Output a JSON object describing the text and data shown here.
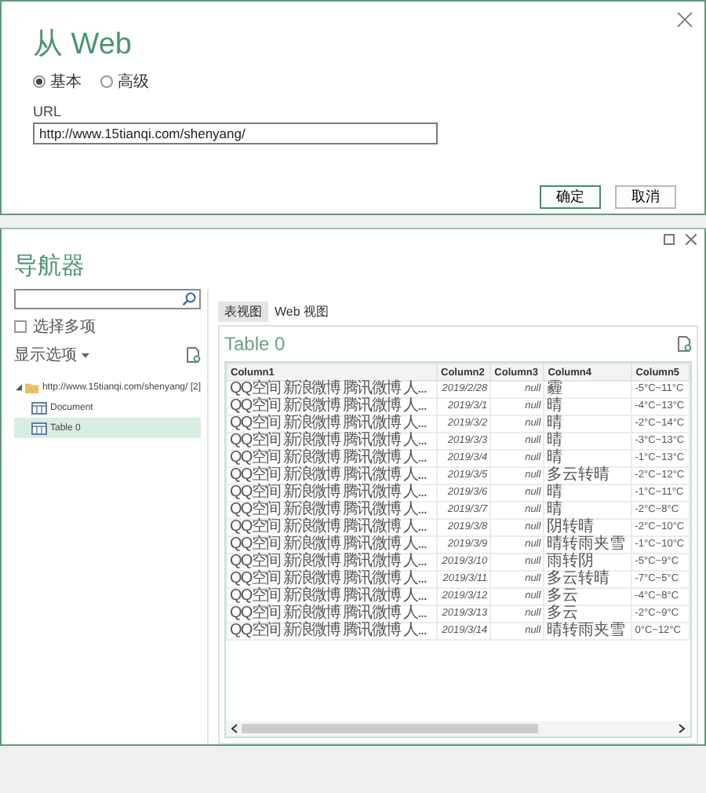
{
  "dialog": {
    "title": "从 Web",
    "modes": [
      {
        "label": "基本",
        "selected": true
      },
      {
        "label": "高级",
        "selected": false
      }
    ],
    "url": {
      "label": "URL",
      "value": "http://www.15tianqi.com/shenyang/"
    },
    "buttons": [
      {
        "label": "确定",
        "primary": true
      },
      {
        "label": "取消",
        "primary": false
      }
    ]
  },
  "navigator": {
    "title": "导航器",
    "select_multiple": {
      "label": "选择多项",
      "checked": false
    },
    "display_options": {
      "label": "显示选项"
    },
    "tree": [
      {
        "label": "http://www.15tianqi.com/shenyang/ [2]",
        "expanded": true,
        "selected": false,
        "children": [
          {
            "label": "Document",
            "selected": false
          },
          {
            "label": "Table 0",
            "selected": true
          }
        ]
      }
    ],
    "view_tabs": [
      {
        "label": "表视图",
        "selected": true
      },
      {
        "label": "Web 视图",
        "selected": false
      }
    ],
    "preview": {
      "title": "Table 0",
      "columns": [
        "Column1",
        "Column2",
        "Column3",
        "Column4",
        "Column5"
      ],
      "rows": [
        [
          "QQ空间 新浪微博 腾讯微博 人...",
          "2019/2/28",
          "null",
          "霾",
          "-5°C~11°C"
        ],
        [
          "QQ空间 新浪微博 腾讯微博 人...",
          "2019/3/1",
          "null",
          "晴",
          "-4°C~13°C"
        ],
        [
          "QQ空间 新浪微博 腾讯微博 人...",
          "2019/3/2",
          "null",
          "晴",
          "-2°C~14°C"
        ],
        [
          "QQ空间 新浪微博 腾讯微博 人...",
          "2019/3/3",
          "null",
          "晴",
          "-3°C~13°C"
        ],
        [
          "QQ空间 新浪微博 腾讯微博 人...",
          "2019/3/4",
          "null",
          "晴",
          "-1°C~13°C"
        ],
        [
          "QQ空间 新浪微博 腾讯微博 人...",
          "2019/3/5",
          "null",
          "多云转晴",
          "-2°C~12°C"
        ],
        [
          "QQ空间 新浪微博 腾讯微博 人...",
          "2019/3/6",
          "null",
          "晴",
          "-1°C~11°C"
        ],
        [
          "QQ空间 新浪微博 腾讯微博 人...",
          "2019/3/7",
          "null",
          "晴",
          "-2°C~8°C"
        ],
        [
          "QQ空间 新浪微博 腾讯微博 人...",
          "2019/3/8",
          "null",
          "阴转晴",
          "-2°C~10°C"
        ],
        [
          "QQ空间 新浪微博 腾讯微博 人...",
          "2019/3/9",
          "null",
          "晴转雨夹雪",
          "-1°C~10°C"
        ],
        [
          "QQ空间 新浪微博 腾讯微博 人...",
          "2019/3/10",
          "null",
          "雨转阴",
          "-5°C~9°C"
        ],
        [
          "QQ空间 新浪微博 腾讯微博 人...",
          "2019/3/11",
          "null",
          "多云转晴",
          "-7°C~5°C"
        ],
        [
          "QQ空间 新浪微博 腾讯微博 人...",
          "2019/3/12",
          "null",
          "多云",
          "-4°C~8°C"
        ],
        [
          "QQ空间 新浪微博 腾讯微博 人...",
          "2019/3/13",
          "null",
          "多云",
          "-2°C~9°C"
        ],
        [
          "QQ空间 新浪微博 腾讯微博 人...",
          "2019/3/14",
          "null",
          "晴转雨夹雪",
          "0°C~12°C"
        ]
      ]
    }
  }
}
